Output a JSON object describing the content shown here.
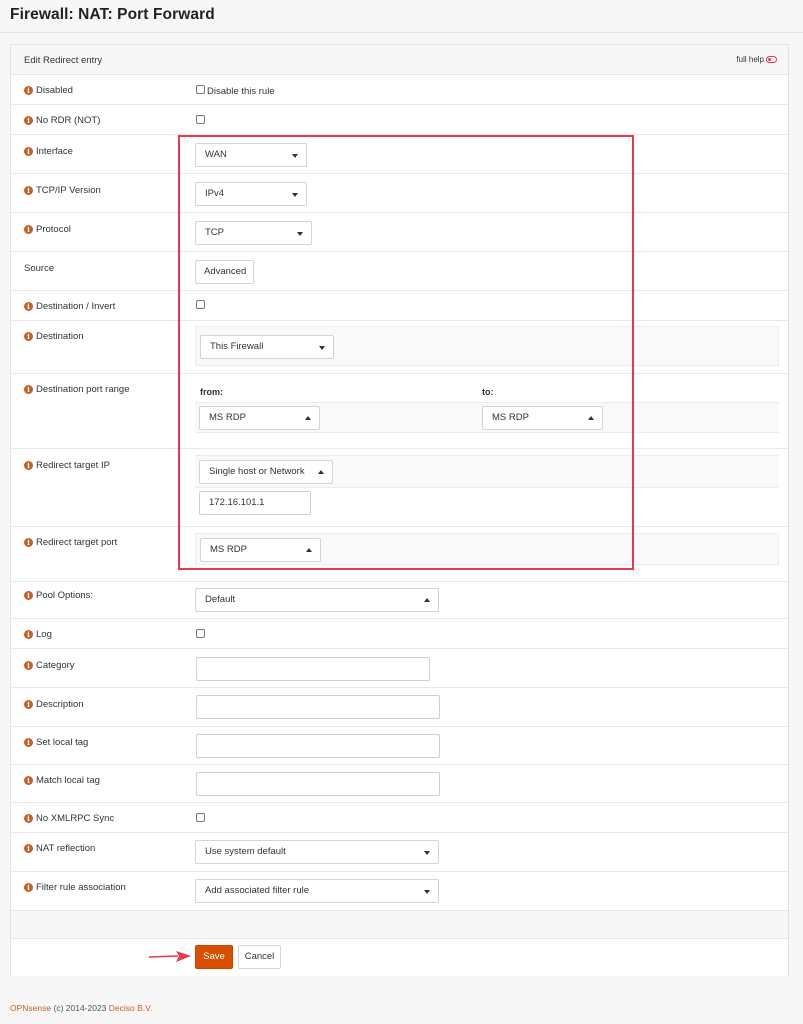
{
  "page": {
    "title": "Firewall: NAT: Port Forward"
  },
  "panel": {
    "heading": "Edit Redirect entry",
    "full_help": "full help"
  },
  "fields": {
    "disabled": {
      "label": "Disabled",
      "checkbox_label": "Disable this rule"
    },
    "no_rdr": {
      "label": "No RDR (NOT)"
    },
    "interface": {
      "label": "Interface",
      "value": "WAN"
    },
    "tcpip": {
      "label": "TCP/IP Version",
      "value": "IPv4"
    },
    "protocol": {
      "label": "Protocol",
      "value": "TCP"
    },
    "source": {
      "label": "Source",
      "button": "Advanced"
    },
    "dest_invert": {
      "label": "Destination / Invert"
    },
    "destination": {
      "label": "Destination",
      "value": "This Firewall"
    },
    "dest_port": {
      "label": "Destination port range",
      "from_label": "from:",
      "to_label": "to:",
      "from_value": "MS RDP",
      "to_value": "MS RDP"
    },
    "redirect_ip": {
      "label": "Redirect target IP",
      "type_value": "Single host or Network",
      "ip_value": "172.16.101.1"
    },
    "redirect_port": {
      "label": "Redirect target port",
      "value": "MS RDP"
    },
    "pool": {
      "label": "Pool Options:",
      "value": "Default"
    },
    "log": {
      "label": "Log"
    },
    "category": {
      "label": "Category",
      "value": ""
    },
    "description": {
      "label": "Description",
      "value": ""
    },
    "set_tag": {
      "label": "Set local tag",
      "value": ""
    },
    "match_tag": {
      "label": "Match local tag",
      "value": ""
    },
    "no_xmlrpc": {
      "label": "No XMLRPC Sync"
    },
    "nat_reflection": {
      "label": "NAT reflection",
      "value": "Use system default"
    },
    "filter_assoc": {
      "label": "Filter rule association",
      "value": "Add associated filter rule"
    }
  },
  "actions": {
    "save": "Save",
    "cancel": "Cancel"
  },
  "footer": {
    "brand": "OPNsense",
    "copyright": "(c) 2014-2023",
    "company": "Deciso B.V."
  },
  "colors": {
    "accent": "#d94f00",
    "highlight": "#e53a4b",
    "info_icon": "#c85f21"
  }
}
